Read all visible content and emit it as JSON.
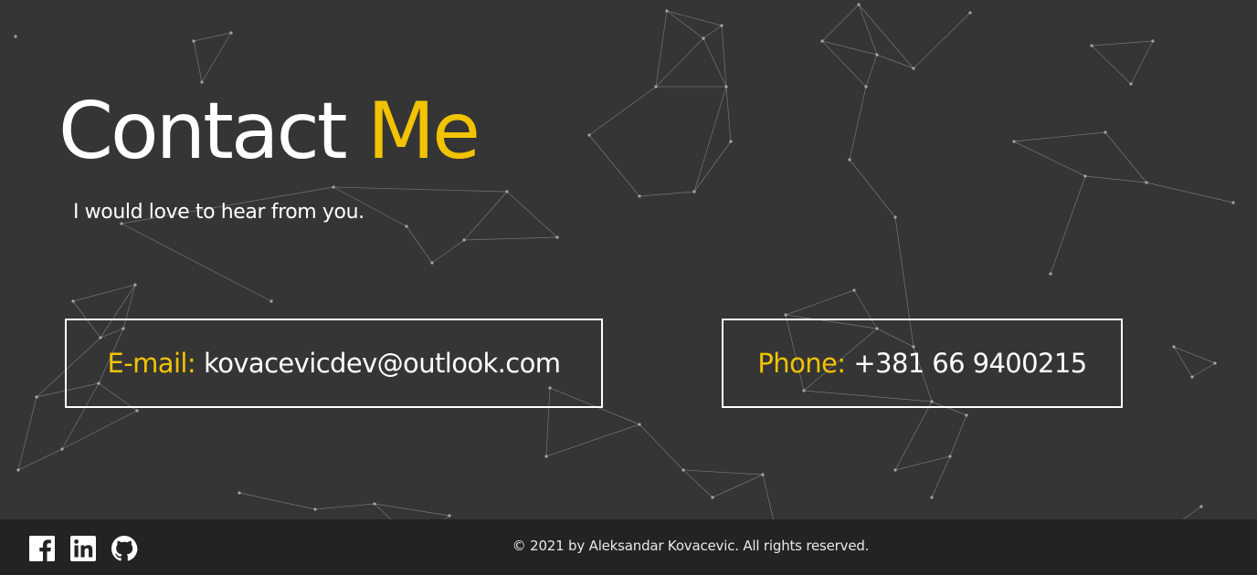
{
  "header": {
    "title_main": "Contact",
    "title_accent": "Me",
    "subtitle": "I would love to hear from you."
  },
  "contacts": {
    "email": {
      "label": "E-mail:",
      "value": "kovacevicdev@outlook.com"
    },
    "phone": {
      "label": "Phone:",
      "value": "+381 66 9400215"
    }
  },
  "footer": {
    "social": [
      {
        "icon": "facebook-icon"
      },
      {
        "icon": "linkedin-icon"
      },
      {
        "icon": "github-icon"
      }
    ],
    "copyright": "© 2021 by Aleksandar Kovacevic. All rights reserved."
  },
  "colors": {
    "background": "#353535",
    "footer_background": "#232323",
    "accent": "#f2c300",
    "text": "#ffffff"
  }
}
